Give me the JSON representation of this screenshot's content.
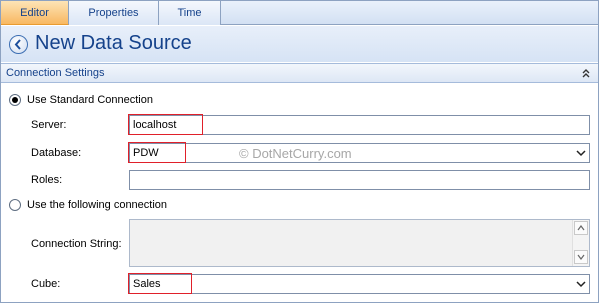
{
  "tabs": [
    {
      "label": "Editor",
      "active": true
    },
    {
      "label": "Properties",
      "active": false
    },
    {
      "label": "Time",
      "active": false
    }
  ],
  "header": {
    "title": "New Data Source",
    "back_icon": "back-arrow-icon"
  },
  "section": {
    "title": "Connection Settings",
    "collapse_icon": "double-chevron-up-icon"
  },
  "form": {
    "standard_connection": {
      "label": "Use Standard Connection",
      "checked": true
    },
    "server": {
      "label": "Server:",
      "value": "localhost"
    },
    "database": {
      "label": "Database:",
      "value": "PDW"
    },
    "roles": {
      "label": "Roles:",
      "value": ""
    },
    "following_connection": {
      "label": "Use the following connection",
      "checked": false
    },
    "connection_string": {
      "label": "Connection String:",
      "value": ""
    },
    "cube": {
      "label": "Cube:",
      "value": "Sales"
    }
  },
  "watermark": "© DotNetCurry.com",
  "colors": {
    "accent": "#15428b",
    "active_tab": "#f8b862",
    "highlight": "#e0202a",
    "border": "#8da2c1"
  }
}
